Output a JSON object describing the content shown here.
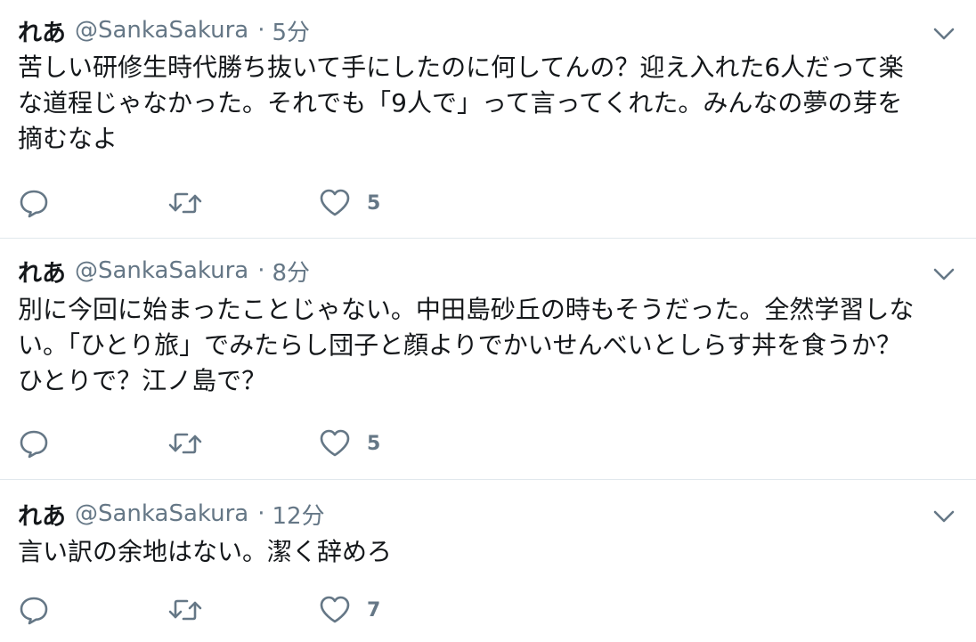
{
  "tweets": [
    {
      "display_name": "れあ",
      "handle": "@SankaSakura",
      "separator": "·",
      "time": "5分",
      "text": "苦しい研修生時代勝ち抜いて手にしたのに何してんの？迎え入れた6人だって楽\nな道程じゃなかった。それでも「9人で」って言ってくれた。みんなの夢の芽を\n摘むなよ",
      "like_count": "5"
    },
    {
      "display_name": "れあ",
      "handle": "@SankaSakura",
      "separator": "·",
      "time": "8分",
      "text": "別に今回に始まったことじゃない。中田島砂丘の時もそうだった。全然学習しな\nい。「ひとり旅」でみたらし団子と顔よりでかいせんべいとしらす丼を食うか？\nひとりで？江ノ島で？",
      "like_count": "5"
    },
    {
      "display_name": "れあ",
      "handle": "@SankaSakura",
      "separator": "·",
      "time": "12分",
      "text": "言い訳の余地はない。潔く辞めろ",
      "like_count": "7"
    }
  ],
  "icons": {
    "reply": "reply-icon",
    "retweet": "retweet-icon",
    "like": "heart-icon",
    "menu": "chevron-down-icon"
  },
  "colors": {
    "text": "#14171a",
    "secondary": "#657786",
    "divider": "#e1e8ed"
  }
}
